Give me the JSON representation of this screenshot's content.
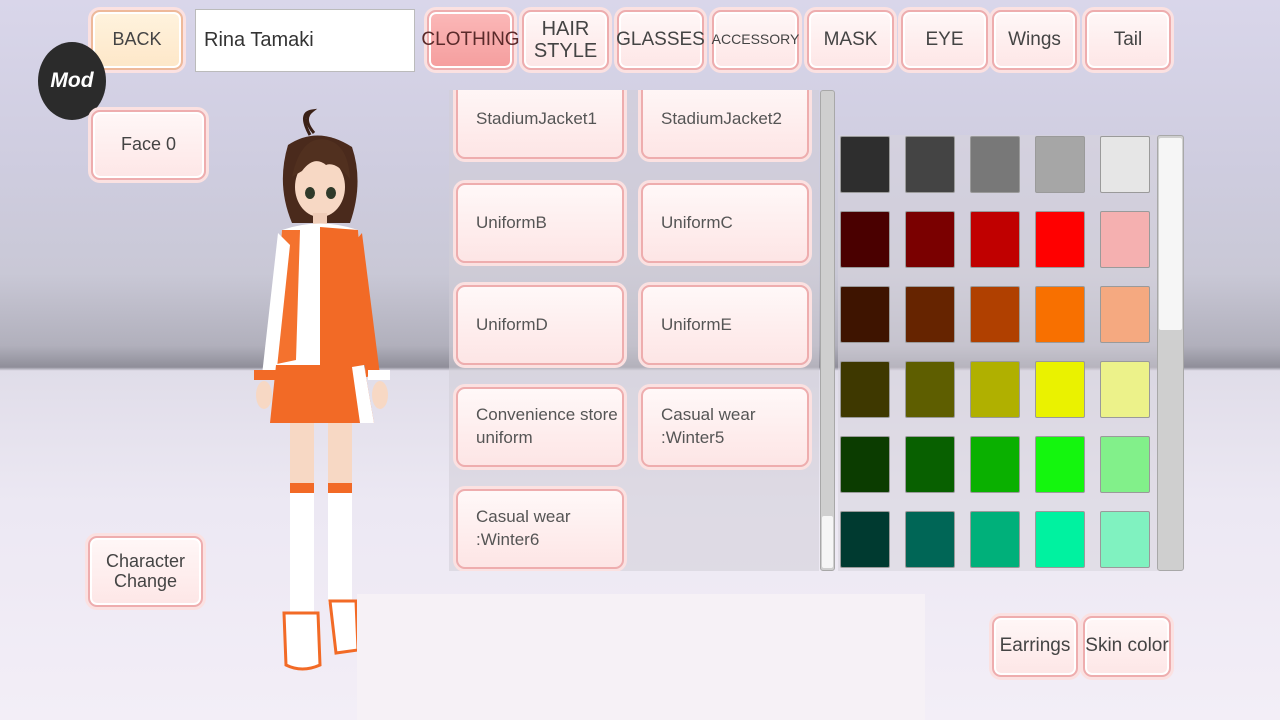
{
  "top": {
    "back_label": "BACK",
    "name_value": "Rina Tamaki",
    "tabs": [
      {
        "label": "CLOTHING",
        "active": true
      },
      {
        "label": "HAIR\nSTYLE",
        "active": false
      },
      {
        "label": "GLASSES",
        "active": false
      },
      {
        "label": "ACCESSORY",
        "active": false
      },
      {
        "label": "MASK",
        "active": false
      },
      {
        "label": "EYE",
        "active": false
      },
      {
        "label": "Wings",
        "active": false
      },
      {
        "label": "Tail",
        "active": false
      }
    ]
  },
  "badge": {
    "label": "Mod"
  },
  "left": {
    "face_label": "Face 0",
    "character_change_label": "Character\nChange"
  },
  "outfits": [
    "StadiumJacket1",
    "StadiumJacket2",
    "UniformB",
    "UniformC",
    "UniformD",
    "UniformE",
    "Convenience store\nuniform",
    "Casual wear\n:Winter5",
    "Casual wear\n:Winter6"
  ],
  "colors": [
    [
      "#2e2e2e",
      "#444444",
      "#787878",
      "#a6a6a6",
      "#e6e6e6"
    ],
    [
      "#4a0000",
      "#7a0000",
      "#c00000",
      "#ff0000",
      "#f5b0b0"
    ],
    [
      "#3e1400",
      "#662400",
      "#b04000",
      "#f87000",
      "#f5a980"
    ],
    [
      "#3e3800",
      "#5e5e00",
      "#b0b000",
      "#eaf200",
      "#ecf28a"
    ],
    [
      "#0b3c00",
      "#086000",
      "#0ab000",
      "#14f60e",
      "#82f08a"
    ],
    [
      "#003a30",
      "#006656",
      "#00b07a",
      "#00f2a0",
      "#80f2c0"
    ]
  ],
  "bottom_right": {
    "earrings_label": "Earrings",
    "skin_label": "Skin color"
  }
}
